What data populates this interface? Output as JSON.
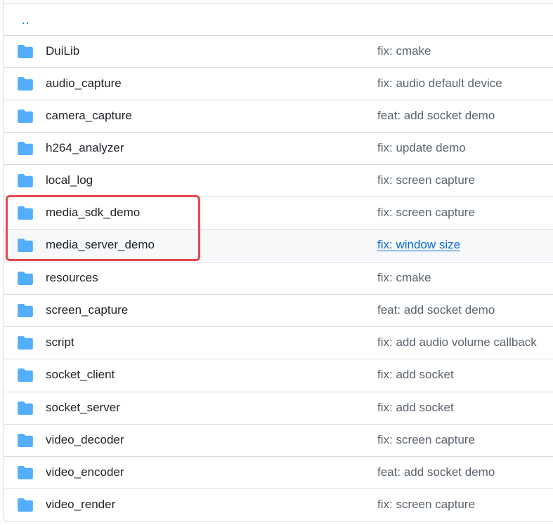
{
  "parent_dir": "..",
  "rows": [
    {
      "name": "DuiLib",
      "message": "fix: cmake"
    },
    {
      "name": "audio_capture",
      "message": "fix: audio default device"
    },
    {
      "name": "camera_capture",
      "message": "feat: add socket demo"
    },
    {
      "name": "h264_analyzer",
      "message": "fix: update demo"
    },
    {
      "name": "local_log",
      "message": "fix: screen capture"
    },
    {
      "name": "media_sdk_demo",
      "message": "fix: screen capture"
    },
    {
      "name": "media_server_demo",
      "message": "fix: window size"
    },
    {
      "name": "resources",
      "message": "fix: cmake"
    },
    {
      "name": "screen_capture",
      "message": "feat: add socket demo"
    },
    {
      "name": "script",
      "message": "fix: add audio volume callback"
    },
    {
      "name": "socket_client",
      "message": "fix: add socket"
    },
    {
      "name": "socket_server",
      "message": "fix: add socket"
    },
    {
      "name": "video_decoder",
      "message": "fix: screen capture"
    },
    {
      "name": "video_encoder",
      "message": "feat: add socket demo"
    },
    {
      "name": "video_render",
      "message": "fix: screen capture"
    }
  ],
  "colors": {
    "folder": "#54aeff",
    "link": "#0969da",
    "highlight": "#e5484d"
  },
  "icons": {
    "folder": "folder-icon"
  }
}
